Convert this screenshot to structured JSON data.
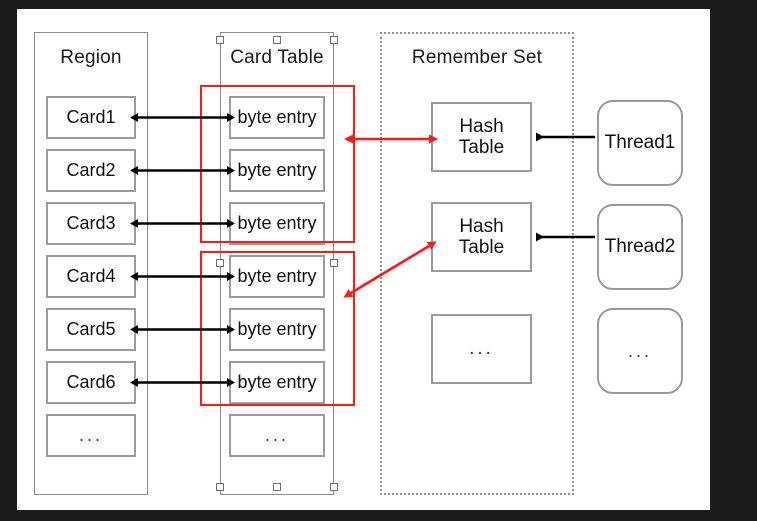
{
  "canvas": {
    "background": "#ffffff",
    "outer_background": "#1b1b1b"
  },
  "colors": {
    "box_stroke": "#9a9aa0",
    "container_stroke": "#8a8a8f",
    "highlight_red": "#ff1a1a",
    "arrow_black": "#000000",
    "text": "#111111",
    "dotted_border": "#8d8d93"
  },
  "columns": [
    {
      "id": "region",
      "title": "Region"
    },
    {
      "id": "card-table",
      "title": "Card Table"
    },
    {
      "id": "remember-set",
      "title": "Remember Set"
    }
  ],
  "region": {
    "title": "Region",
    "cells": [
      {
        "label": "Card1"
      },
      {
        "label": "Card2"
      },
      {
        "label": "Card3"
      },
      {
        "label": "Card4"
      },
      {
        "label": "Card5"
      },
      {
        "label": "Card6"
      },
      {
        "label": "..."
      }
    ]
  },
  "card_table": {
    "title": "Card Table",
    "selected": true,
    "cells": [
      {
        "label": "byte entry"
      },
      {
        "label": "byte entry"
      },
      {
        "label": "byte entry"
      },
      {
        "label": "byte entry"
      },
      {
        "label": "byte entry"
      },
      {
        "label": "byte entry"
      },
      {
        "label": "..."
      }
    ],
    "highlight_groups": [
      {
        "name": "upper-group",
        "rows": [
          0,
          1,
          2
        ]
      },
      {
        "name": "lower-group",
        "rows": [
          3,
          4,
          5
        ]
      }
    ]
  },
  "remember_set": {
    "title": "Remember Set",
    "entries": [
      {
        "line1": "Hash",
        "line2": "Table"
      },
      {
        "line1": "Hash",
        "line2": "Table"
      },
      {
        "line1": "...",
        "line2": ""
      }
    ]
  },
  "threads": [
    {
      "label": "Thread1"
    },
    {
      "label": "Thread2"
    },
    {
      "label": "..."
    }
  ],
  "connections": {
    "card_to_entry": {
      "style": "double-headed",
      "color": "#000000",
      "count": 6
    },
    "entry_group_to_hash_table": {
      "style": "double-headed",
      "color": "#ff1a1a",
      "count": 2
    },
    "thread_to_hash_table": {
      "style": "single-headed",
      "color": "#000000",
      "count": 2
    }
  }
}
